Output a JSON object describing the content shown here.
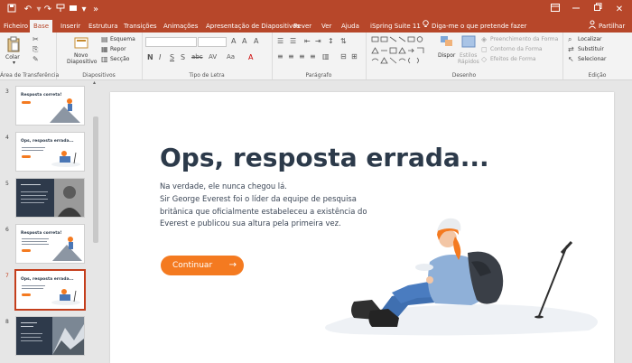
{
  "window": {
    "title_bar_color": "#b7472a",
    "controls": [
      "minimize",
      "restore",
      "close"
    ],
    "options_glyph": "▾"
  },
  "tabs": [
    {
      "label": "Ficheiro",
      "active": false
    },
    {
      "label": "Base",
      "active": true
    },
    {
      "label": "Inserir",
      "active": false
    },
    {
      "label": "Estrutura",
      "active": false
    },
    {
      "label": "Transições",
      "active": false
    },
    {
      "label": "Animações",
      "active": false
    },
    {
      "label": "Apresentação de Diapositivos",
      "active": false
    },
    {
      "label": "Rever",
      "active": false
    },
    {
      "label": "Ver",
      "active": false
    },
    {
      "label": "Ajuda",
      "active": false
    },
    {
      "label": "iSpring Suite 11",
      "active": false
    }
  ],
  "tell_me": "Diga-me o que pretende fazer",
  "share": "Partilhar",
  "ribbon": {
    "clipboard": {
      "paste": "Colar",
      "label": "Área de Transferência"
    },
    "slides": {
      "new_slide_line1": "Novo",
      "new_slide_line2": "Diapositivo",
      "layout": "Esquema",
      "reset": "Repor",
      "section": "Secção",
      "label": "Diapositivos"
    },
    "font": {
      "label": "Tipo de Letra",
      "bold": "N",
      "italic": "I",
      "underline": "S",
      "shadow": "S",
      "strike": "abc",
      "spacing": "AV",
      "case": "Aa"
    },
    "paragraph": {
      "label": "Parágrafo"
    },
    "drawing": {
      "arrange": "Dispor",
      "quick_styles_line1": "Estilos",
      "quick_styles_line2": "Rápidos",
      "shape_fill": "Preenchimento da Forma",
      "shape_outline": "Contorno da Forma",
      "shape_effects": "Efeitos de Forma",
      "label": "Desenho"
    },
    "editing": {
      "find": "Localizar",
      "replace": "Substituir",
      "select": "Selecionar",
      "label": "Edição"
    }
  },
  "thumbnails": [
    {
      "num": "3",
      "title": "Resposta correta!",
      "selected": false,
      "style": "light"
    },
    {
      "num": "4",
      "title": "Ops, resposta errada...",
      "selected": false,
      "style": "light"
    },
    {
      "num": "5",
      "title": "",
      "selected": false,
      "style": "dark"
    },
    {
      "num": "6",
      "title": "Resposta correta!",
      "selected": false,
      "style": "light"
    },
    {
      "num": "7",
      "title": "Ops, resposta errada...",
      "selected": true,
      "style": "light"
    },
    {
      "num": "8",
      "title": "",
      "selected": false,
      "style": "dark"
    }
  ],
  "slide": {
    "title": "Ops, resposta errada...",
    "body": [
      "Na verdade, ele nunca chegou lá.",
      "Sir George Everest foi o líder da equipe de pesquisa",
      "britânica que oficialmente estabeleceu a existência do",
      "Everest e publicou sua altura pela primeira vez."
    ],
    "button_label": "Continuar",
    "button_arrow": "→",
    "accent_color": "#f47a20",
    "title_color": "#2c3a4a"
  }
}
